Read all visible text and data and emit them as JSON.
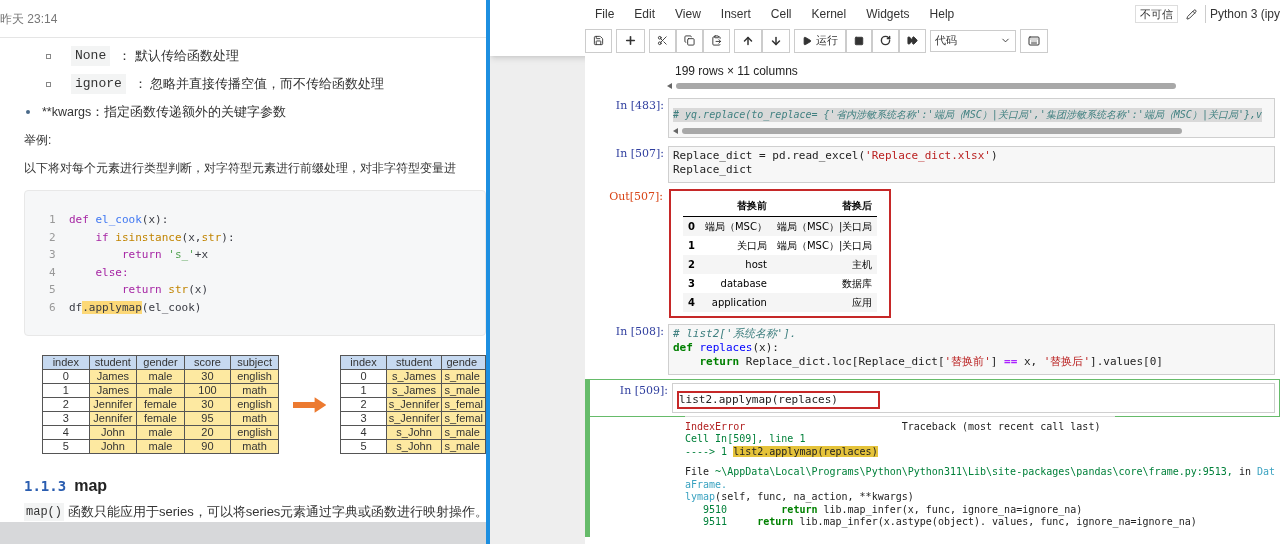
{
  "article": {
    "timestamp": "昨天 23:14",
    "bullets": [
      {
        "kind": "sub",
        "code": "None",
        "text": "： 默认传给函数处理"
      },
      {
        "kind": "sub",
        "code": "ignore",
        "text": "： 忽略并直接传播空值，而不传给函数处理"
      },
      {
        "kind": "main",
        "text": "**kwargs：指定函数传递额外的关键字参数"
      }
    ],
    "paragraphs": [
      "举例:",
      "以下将对每个元素进行类型判断，对字符型元素进行前缀处理，对非字符型变量进"
    ],
    "code_block": [
      {
        "num": "1",
        "tokens": [
          {
            "text": "def ",
            "kind": "kw"
          },
          {
            "text": "el_cook",
            "kind": "fn"
          },
          {
            "text": "(x):",
            "kind": "p"
          }
        ]
      },
      {
        "num": "2",
        "tokens": [
          {
            "text": "    if ",
            "kind": "kw"
          },
          {
            "text": "isinstance",
            "kind": "builtin"
          },
          {
            "text": "(x,",
            "kind": "p"
          },
          {
            "text": "str",
            "kind": "builtin"
          },
          {
            "text": "):",
            "kind": "p"
          }
        ]
      },
      {
        "num": "3",
        "tokens": [
          {
            "text": "        return ",
            "kind": "kw"
          },
          {
            "text": "'s_'",
            "kind": "str"
          },
          {
            "text": "+x",
            "kind": "p"
          }
        ]
      },
      {
        "num": "4",
        "tokens": [
          {
            "text": "    else:",
            "kind": "kw"
          }
        ]
      },
      {
        "num": "5",
        "tokens": [
          {
            "text": "        return ",
            "kind": "kw"
          },
          {
            "text": "str",
            "kind": "builtin"
          },
          {
            "text": "(x)",
            "kind": "p"
          }
        ]
      },
      {
        "num": "6",
        "tokens": [
          {
            "text": "df",
            "kind": "p"
          },
          {
            "text": ".applymap",
            "kind": "hl"
          },
          {
            "text": "(el_cook)",
            "kind": "p"
          }
        ]
      }
    ],
    "tables": [
      {
        "columns": [
          "index",
          "student",
          "gender",
          "score",
          "subject"
        ],
        "rows": [
          [
            "0",
            "James",
            "male",
            "30",
            "english"
          ],
          [
            "1",
            "James",
            "male",
            "100",
            "math"
          ],
          [
            "2",
            "Jennifer",
            "female",
            "30",
            "english"
          ],
          [
            "3",
            "Jennifer",
            "female",
            "95",
            "math"
          ],
          [
            "4",
            "John",
            "male",
            "20",
            "english"
          ],
          [
            "5",
            "John",
            "male",
            "90",
            "math"
          ]
        ]
      },
      {
        "columns": [
          "index",
          "student",
          "gende"
        ],
        "rows": [
          [
            "0",
            "s_James",
            "s_male"
          ],
          [
            "1",
            "s_James",
            "s_male"
          ],
          [
            "2",
            "s_Jennifer",
            "s_femal"
          ],
          [
            "3",
            "s_Jennifer",
            "s_femal"
          ],
          [
            "4",
            "s_John",
            "s_male"
          ],
          [
            "5",
            "s_John",
            "s_male"
          ]
        ]
      }
    ],
    "heading": {
      "number": "1.1.3",
      "title": "map"
    },
    "note": {
      "code": "map()",
      "text": "函数只能应用于series，可以将series元素通过字典或函数进行映射操作。"
    }
  },
  "notebook": {
    "menu": [
      "File",
      "Edit",
      "View",
      "Insert",
      "Cell",
      "Kernel",
      "Widgets",
      "Help"
    ],
    "trust": "不可信",
    "kernel": "Python 3 (ipy",
    "run_label": "运行",
    "cell_type": "代码",
    "cells": [
      {
        "kind": "output",
        "text": "199 rows × 11 columns"
      },
      {
        "kind": "code",
        "prompt": "In [483]:",
        "selected": false,
        "annotated": false,
        "text_selected": true,
        "lines": [
          [
            {
              "text": "# ",
              "kind": "comment"
            },
            {
              "text": "yq.replace(to_replace= {'省内涉敏系统名称':'端局（MSC）|关口局','集团涉敏系统名称':'端局（MSC）|关口局'},v",
              "kind": "comment"
            }
          ]
        ]
      },
      {
        "kind": "code",
        "prompt": "In [507]:",
        "selected": false,
        "annotated": false,
        "text_selected": false,
        "lines": [
          [
            {
              "text": "Replace_dict = pd.read_excel(",
              "kind": "p"
            },
            {
              "text": "'Replace_dict.xlsx'",
              "kind": "str"
            },
            {
              "text": ")",
              "kind": "p"
            }
          ],
          [
            {
              "text": "Replace_dict",
              "kind": "p"
            }
          ]
        ]
      },
      {
        "kind": "dataframe",
        "prompt": "Out[507]:",
        "annotated": true,
        "columns": [
          "",
          "替换前",
          "替换后"
        ],
        "rows": [
          [
            "0",
            "端局（MSC）",
            "端局（MSC）|关口局"
          ],
          [
            "1",
            "关口局",
            "端局（MSC）|关口局"
          ],
          [
            "2",
            "host",
            "主机"
          ],
          [
            "3",
            "database",
            "数据库"
          ],
          [
            "4",
            "application",
            "应用"
          ]
        ]
      },
      {
        "kind": "code",
        "prompt": "In [508]:",
        "selected": false,
        "annotated": false,
        "text_selected": false,
        "lines": [
          [
            {
              "text": "# list2['系统名称'].",
              "kind": "comment"
            }
          ],
          [
            {
              "text": "def ",
              "kind": "kw"
            },
            {
              "text": "replaces",
              "kind": "fn"
            },
            {
              "text": "(x):",
              "kind": "p"
            }
          ],
          [
            {
              "text": "    return ",
              "kind": "kw"
            },
            {
              "text": "Replace_dict.loc[Replace_dict[",
              "kind": "p"
            },
            {
              "text": "'替换前'",
              "kind": "str"
            },
            {
              "text": "] ",
              "kind": "p"
            },
            {
              "text": "==",
              "kind": "op"
            },
            {
              "text": " x, ",
              "kind": "p"
            },
            {
              "text": "'替换后'",
              "kind": "str"
            },
            {
              "text": "].values[0]",
              "kind": "p"
            }
          ]
        ]
      },
      {
        "kind": "code",
        "prompt": "In [509]:",
        "selected": true,
        "annotated": true,
        "text_selected": false,
        "lines": [
          [
            {
              "text": "list2.applymap(replaces)",
              "kind": "p"
            }
          ]
        ]
      },
      {
        "kind": "error",
        "blocks": [
          [
            [
              {
                "text": "IndexError",
                "kind": "ename"
              },
              {
                "text": "                          Traceback (most recent call last)",
                "kind": "p"
              }
            ],
            [
              {
                "text": "Cell In[509], line 1",
                "kind": "grn"
              }
            ],
            [
              {
                "text": "----> 1 ",
                "kind": "grn"
              },
              {
                "text": "list2.applymap(replaces)",
                "kind": "hl"
              }
            ]
          ],
          [
            [
              {
                "text": "File ",
                "kind": "p"
              },
              {
                "text": "~\\AppData\\Local\\Programs\\Python\\Python311\\Lib\\site-packages\\pandas\\core\\frame.py:9513,",
                "kind": "grn"
              },
              {
                "text": " in ",
                "kind": "p"
              },
              {
                "text": "DataFrame.",
                "kind": "cyan"
              }
            ],
            [
              {
                "text": "lymap",
                "kind": "cyan"
              },
              {
                "text": "(self, func, na_action, **kwargs)",
                "kind": "p"
              }
            ],
            [
              {
                "text": "   9510",
                "kind": "grn"
              },
              {
                "text": "         return",
                "kind": "kw"
              },
              {
                "text": " lib.map_infer(x, func, ignore_na=ignore_na)",
                "kind": "p"
              }
            ],
            [
              {
                "text": "   9511",
                "kind": "grn"
              },
              {
                "text": "     return",
                "kind": "kw"
              },
              {
                "text": " lib.map_infer(x.astype(object). values, func, ignore_na=ignore_na)",
                "kind": "p"
              }
            ]
          ]
        ]
      }
    ]
  }
}
